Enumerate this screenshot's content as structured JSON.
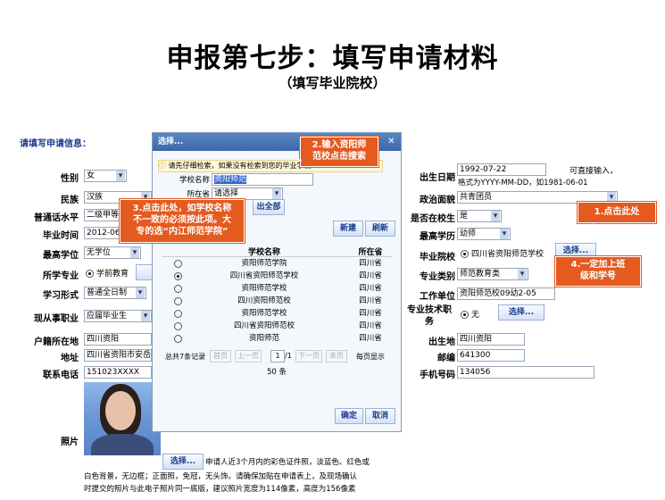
{
  "heading": {
    "title": "申报第七步：填写申请材料",
    "subtitle": "（填写毕业院校）"
  },
  "section_title": "请填写申请信息：",
  "left_form": [
    {
      "label": "性别",
      "value": "女",
      "type": "select"
    },
    {
      "label": "民族",
      "value": "汉族",
      "type": "select"
    },
    {
      "label": "普通话水平",
      "value": "二级甲等",
      "type": "select"
    },
    {
      "label": "毕业时间",
      "value": "2012-06",
      "type": "text"
    },
    {
      "label": "最高学位",
      "value": "无学位",
      "type": "select"
    },
    {
      "label": "所学专业",
      "value": "学前教育",
      "type": "radio"
    },
    {
      "label": "学习形式",
      "value": "普通全日制",
      "type": "select"
    },
    {
      "label": "现从事职业",
      "value": "应届毕业生",
      "type": "select"
    },
    {
      "label": "户籍所在地",
      "value": "四川资阳",
      "type": "text"
    },
    {
      "label": "地址",
      "value": "四川省资阳市安岳县",
      "type": "text"
    },
    {
      "label": "联系电话",
      "value": "151023XXXX",
      "type": "text"
    }
  ],
  "right_form": {
    "birth_label": "出生日期",
    "birth_value": "1992-07-22",
    "birth_hint1": "可直接输入，",
    "birth_hint2": "格式为YYYY-MM-DD，如1981-06-01",
    "political_label": "政治面貌",
    "political_value": "共青团员",
    "inschool_label": "是否在校生",
    "inschool_value": "是",
    "education_label": "最高学历",
    "education_value": "幼师",
    "school_label": "毕业院校",
    "school_value": "四川省资阳师范学校",
    "school_btn": "选择...",
    "major_type_label": "专业类别",
    "major_type_value": "师范教育类",
    "work_label": "工作单位",
    "work_value": "资阳师范校09幼2-05",
    "title_label": "专业技术职务",
    "title_value": "无",
    "title_btn": "选择...",
    "birthplace_label": "出生地",
    "birthplace_value": "四川资阳",
    "zip_label": "邮编",
    "zip_value": "641300",
    "mobile_label": "手机号码",
    "mobile_value": "134056"
  },
  "photo": {
    "label": "照片",
    "btn": "选择...",
    "desc1": "申请人近3个月内的彩色证件照，淡蓝色、红色或",
    "desc2": "白色背景，无边框；正面照，免冠，无头饰。请确保加贴在申请表上，及现场确认",
    "desc3": "时提交的照片与此电子照片同一底版，建议照片宽度为114像素，高度为156像素"
  },
  "dialog": {
    "title": "选择...",
    "note": "请先仔细检索，如果没有检索到您的毕业学校",
    "school_name_label": "学校名称",
    "school_name_value": "资阳师范",
    "region_label": "所在省",
    "region_value": "请选择",
    "show_all_btn": "出全部",
    "new_btn": "新建",
    "refresh_btn": "刷新",
    "col_name": "学校名称",
    "col_province": "所在省",
    "rows": [
      {
        "name": "资阳师范学院",
        "province": "四川省",
        "selected": false
      },
      {
        "name": "四川省资阳师范学校",
        "province": "四川省",
        "selected": true
      },
      {
        "name": "资阳师范学校",
        "province": "四川省",
        "selected": false
      },
      {
        "name": "四川资阳师范校",
        "province": "四川省",
        "selected": false
      },
      {
        "name": "资阳师范学校",
        "province": "四川省",
        "selected": false
      },
      {
        "name": "四川省资阳师范校",
        "province": "四川省",
        "selected": false
      },
      {
        "name": "资阳师范",
        "province": "四川省",
        "selected": false
      }
    ],
    "total": "总共7条记录",
    "first": "首页",
    "prev": "上一页",
    "page": "1",
    "page_of": "/1",
    "next": "下一页",
    "last": "末页",
    "per_page": "每页显示",
    "page_size": "50",
    "page_size_unit": "条",
    "ok_btn": "确定",
    "cancel_btn": "取消"
  },
  "callouts": {
    "c1": "1.点击此处",
    "c2_l1": "2.输入资阳师",
    "c2_l2": "范校点击搜索",
    "c3_l1": "3.点击此处，如学校名称",
    "c3_l2": "不一致的必须按此项。大",
    "c3_l3": "专的选“内江师范学院”",
    "c4_l1": "4.一定加上班",
    "c4_l2": "级和学号"
  },
  "colors": {
    "callout": "#e45a1f",
    "dialog_title": "#3b66a8"
  }
}
